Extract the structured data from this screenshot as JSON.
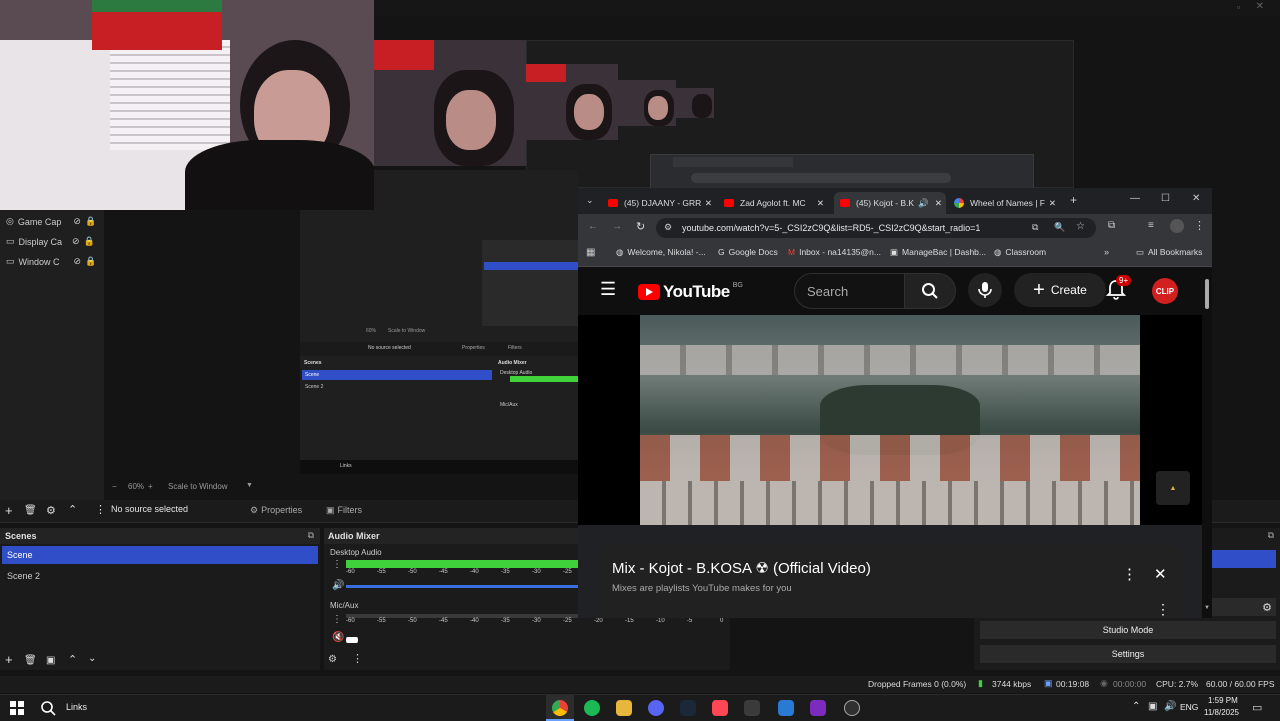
{
  "obs": {
    "sources": [
      {
        "label": "Game Cap"
      },
      {
        "label": "Display Ca"
      },
      {
        "label": "Window C"
      }
    ],
    "preview_zoom": "60%",
    "scale_mode": "Scale to Window",
    "no_source": "No source selected",
    "properties_label": "Properties",
    "filters_label": "Filters",
    "scenes_title": "Scenes",
    "scenes": [
      {
        "label": "Scene"
      },
      {
        "label": "Scene 2"
      }
    ],
    "mixer_title": "Audio Mixer",
    "channels": [
      {
        "label": "Desktop Audio"
      },
      {
        "label": "Mic/Aux"
      }
    ],
    "meter_ticks": [
      "-60",
      "-55",
      "-50",
      "-45",
      "-40",
      "-35",
      "-30",
      "-25",
      "-20",
      "-15",
      "-10",
      "-5",
      "0"
    ],
    "controls": {
      "studio_mode": "Studio Mode",
      "settings": "Settings"
    },
    "status": {
      "dropped": "Dropped Frames 0 (0.0%)",
      "bitrate": "3744 kbps",
      "rec_time": "00:19:08",
      "stream_time": "00:00:00",
      "cpu": "CPU: 2.7%",
      "fps": "60.00 / 60.00 FPS"
    }
  },
  "nested": {
    "no_source": "No source selected",
    "properties": "Properties",
    "filters": "Filters",
    "scenes_title": "Scenes",
    "scenes": [
      "Scene",
      "Scene 2"
    ],
    "mixer_title": "Audio Mixer",
    "desktop_audio": "Desktop Audio",
    "mic_aux": "Mic/Aux",
    "zoom": "60%",
    "scale": "Scale to Window",
    "taskbar_search": "Links"
  },
  "browser": {
    "tabs": [
      {
        "label": "(45) DJAANY - GRR"
      },
      {
        "label": "Zad Agolot ft. MC"
      },
      {
        "label": "(45) Kojot - B.K"
      },
      {
        "label": "Wheel of Names | F"
      }
    ],
    "url": "youtube.com/watch?v=5-_CSI2zC9Q&list=RD5-_CSI2zC9Q&start_radio=1",
    "bookmarks": [
      {
        "label": "Welcome, Nikola! -..."
      },
      {
        "label": "Google Docs"
      },
      {
        "label": "Inbox - na14135@n..."
      },
      {
        "label": "ManageBac | Dashb..."
      },
      {
        "label": "Classroom"
      }
    ],
    "all_bookmarks": "All Bookmarks",
    "youtube": {
      "logo_text": "YouTube",
      "region": "BG",
      "search_placeholder": "Search",
      "create_label": "Create",
      "notification_count": "9+",
      "avatar_text": "CLIP",
      "mix_title": "Mix - Kojot - B.KOSA ☢ (Official Video)",
      "mix_subtitle": "Mixes are playlists YouTube makes for you"
    }
  },
  "taskbar": {
    "search_text": "Links",
    "language": "ENG",
    "time": "1:59 PM",
    "date": "11/8/2025"
  },
  "colors": {
    "obs_select": "#2f4ec7",
    "meter_green": "#3fd23a",
    "youtube_red": "#ff0000"
  }
}
